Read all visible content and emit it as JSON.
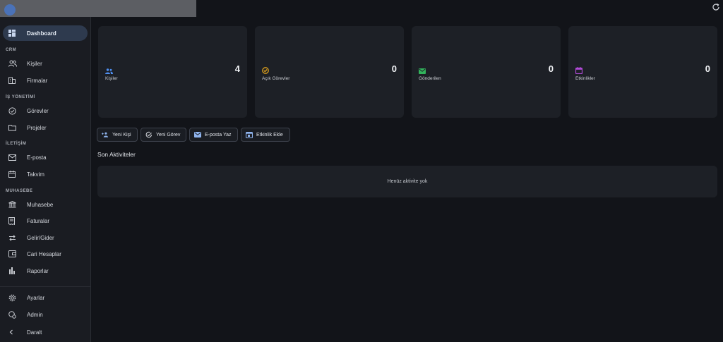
{
  "sidebar": {
    "dashboard": "Dashboard",
    "sections": {
      "crm": "CRM",
      "is_yonetimi": "İŞ YÖNETİMİ",
      "iletisim": "İLETİŞİM",
      "muhasebe": "MUHASEBE"
    },
    "items": {
      "kisiler": "Kişiler",
      "firmalar": "Firmalar",
      "gorevler": "Görevler",
      "projeler": "Projeler",
      "eposta": "E-posta",
      "takvim": "Takvim",
      "muhasebe": "Muhasebe",
      "faturalar": "Faturalar",
      "gelir_gider": "Gelir/Gider",
      "cari_hesaplar": "Cari Hesaplar",
      "raporlar": "Raporlar"
    },
    "bottom": {
      "ayarlar": "Ayarlar",
      "admin": "Admin",
      "daralt": "Daralt"
    }
  },
  "stats": [
    {
      "label": "Kişiler",
      "value": "4",
      "icon": "people-icon",
      "color": "#4f8ff0"
    },
    {
      "label": "Açık Görevler",
      "value": "0",
      "icon": "task-check-icon",
      "color": "#e0a21c"
    },
    {
      "label": "Gönderilen",
      "value": "0",
      "icon": "mail-icon",
      "color": "#32b35c"
    },
    {
      "label": "Etkinlikler",
      "value": "0",
      "icon": "calendar-icon",
      "color": "#b04ad6"
    }
  ],
  "quick_actions": {
    "yeni_kisi": "Yeni Kişi",
    "yeni_gorev": "Yeni Görev",
    "eposta_yaz": "E-posta Yaz",
    "etkinlik_ekle": "Etkinlik Ekle"
  },
  "activity": {
    "title": "Son Aktiviteler",
    "empty": "Henüz aktivite yok"
  }
}
